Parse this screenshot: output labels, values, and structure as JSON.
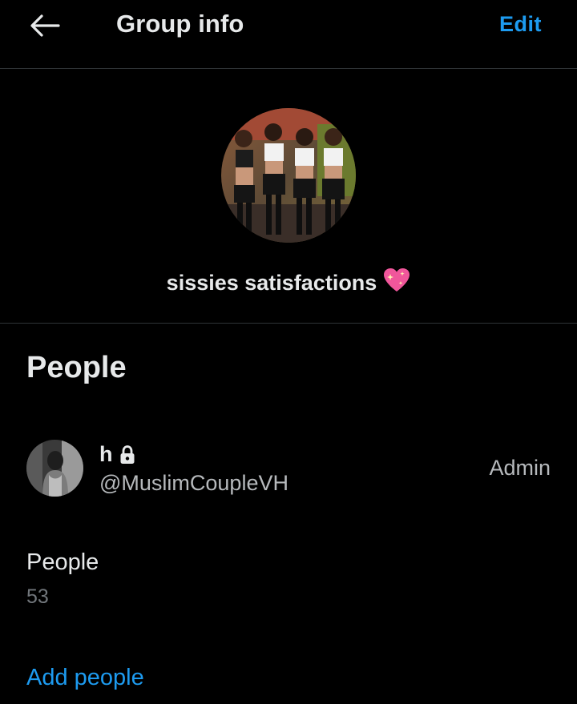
{
  "header": {
    "title": "Group info",
    "edit_label": "Edit"
  },
  "group": {
    "name": "sissies satisfactions",
    "emoji": "sparkling-heart"
  },
  "people_section": {
    "heading": "People",
    "members": [
      {
        "name": "h",
        "protected": true,
        "handle": "@MuslimCoupleVH",
        "role": "Admin"
      }
    ],
    "count_label": "People",
    "count_value": "53",
    "add_label": "Add people"
  },
  "colors": {
    "background": "#000000",
    "accent": "#1d9bf0",
    "primary_text": "#e7e9ea",
    "secondary_text": "#71767b",
    "divider": "#2f3336",
    "heart": "#f0569b"
  }
}
